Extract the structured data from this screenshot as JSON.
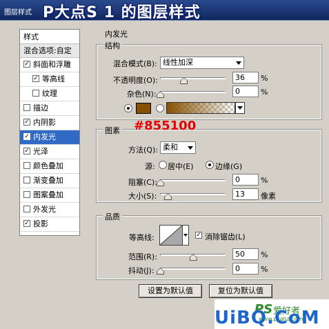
{
  "window": {
    "title": "图层样式",
    "tutorial_title": "P大点S 1 的图层样式"
  },
  "styles_panel": {
    "header": "样式",
    "blend_options": "混合选项:自定",
    "items": [
      {
        "label": "斜面和浮雕",
        "checked": true
      },
      {
        "label": "等高线",
        "checked": true
      },
      {
        "label": "纹理",
        "checked": false
      },
      {
        "label": "描边",
        "checked": false
      },
      {
        "label": "内阴影",
        "checked": true
      },
      {
        "label": "内发光",
        "checked": true,
        "selected": true
      },
      {
        "label": "光泽",
        "checked": true
      },
      {
        "label": "颜色叠加",
        "checked": false
      },
      {
        "label": "渐变叠加",
        "checked": false
      },
      {
        "label": "图案叠加",
        "checked": false
      },
      {
        "label": "外发光",
        "checked": false
      },
      {
        "label": "投影",
        "checked": true
      }
    ]
  },
  "inner_glow": {
    "title": "内发光",
    "structure": {
      "title": "结构",
      "blend_mode_label": "混合模式(B):",
      "blend_mode_value": "线性加深",
      "opacity_label": "不透明度(O):",
      "opacity_value": "36",
      "opacity_unit": "%",
      "opacity_level": 36,
      "noise_label": "杂色(N):",
      "noise_value": "0",
      "noise_unit": "%",
      "noise_level": 0,
      "color": "#855100"
    },
    "elements": {
      "title": "图素",
      "annotation": "#855100",
      "technique_label": "方法(Q):",
      "technique_value": "柔和",
      "source_label": "源:",
      "source_center": "居中(E)",
      "source_edge": "边缘(G)",
      "choke_label": "阻塞(C):",
      "choke_value": "0",
      "choke_unit": "%",
      "choke_level": 0,
      "size_label": "大小(S):",
      "size_value": "13",
      "size_unit": "像素"
    },
    "quality": {
      "title": "品质",
      "contour_label": "等高线:",
      "antialias_label": "消除锯齿(L)",
      "range_label": "范围(R):",
      "range_value": "50",
      "range_unit": "%",
      "range_level": 50,
      "jitter_label": "抖动(J):",
      "jitter_value": "0",
      "jitter_unit": "%",
      "jitter_level": 0
    },
    "buttons": {
      "make_default": "设置为默认值",
      "reset_default": "复位为默认值"
    }
  },
  "watermark": {
    "logo": "UiBQ.CoM",
    "ps": "PS",
    "cn": "爱好者",
    "url": "www.psahz.com"
  },
  "colors": {
    "glow_color": "#855100",
    "selection": "#316ac5",
    "annotation": "#e60000"
  }
}
